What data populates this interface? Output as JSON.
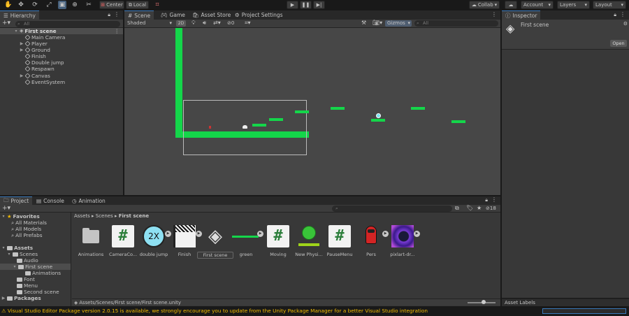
{
  "toolbar": {
    "center_label": "Center",
    "local_label": "Local",
    "collab_label": "Collab",
    "account_label": "Account",
    "layers_label": "Layers",
    "layout_label": "Layout"
  },
  "hierarchy": {
    "tab_label": "Hierarchy",
    "search_placeholder": "All",
    "scene_name": "First scene",
    "items": [
      {
        "label": "Main Camera",
        "has_children": false
      },
      {
        "label": "Player",
        "has_children": true
      },
      {
        "label": "Ground",
        "has_children": true
      },
      {
        "label": "Finish",
        "has_children": false
      },
      {
        "label": "Double jump",
        "has_children": false
      },
      {
        "label": "Respawn",
        "has_children": false
      },
      {
        "label": "Canvas",
        "has_children": true
      },
      {
        "label": "EventSystem",
        "has_children": false
      }
    ]
  },
  "scene_tabs": {
    "scene": "Scene",
    "game": "Game",
    "asset_store": "Asset Store",
    "project_settings": "Project Settings"
  },
  "scene_toolbar": {
    "shading_mode": "Shaded",
    "mode_2d": "2D",
    "hidden_count": "0",
    "gizmos_label": "Gizmos",
    "search_placeholder": "All"
  },
  "inspector": {
    "tab_label": "Inspector",
    "object_name": "First scene",
    "open_button": "Open",
    "asset_labels": "Asset Labels"
  },
  "bottom_tabs": {
    "project": "Project",
    "console": "Console",
    "animation": "Animation"
  },
  "project": {
    "hidden_count": "18",
    "favorites_label": "Favorites",
    "favorites": [
      "All Materials",
      "All Models",
      "All Prefabs"
    ],
    "assets_label": "Assets",
    "tree": {
      "scenes": "Scenes",
      "audio": "Audio",
      "first_scene": "First scene",
      "animations": "Animations",
      "font": "Font",
      "menu": "Menu",
      "second_scene": "Second scene",
      "packages": "Packages"
    },
    "breadcrumb": [
      "Assets",
      "Scenes",
      "First scene"
    ],
    "assets": [
      {
        "label": "Animations",
        "kind": "folder"
      },
      {
        "label": "CameraCo...",
        "kind": "script"
      },
      {
        "label": "double jump",
        "kind": "prefab-2x"
      },
      {
        "label": "Finish",
        "kind": "prefab-finish"
      },
      {
        "label": "First scene",
        "kind": "scene"
      },
      {
        "label": "green",
        "kind": "prefab-green"
      },
      {
        "label": "Moving",
        "kind": "script"
      },
      {
        "label": "New Physi...",
        "kind": "physics-material"
      },
      {
        "label": "PauseMenu",
        "kind": "script"
      },
      {
        "label": "Pers",
        "kind": "prefab-pers"
      },
      {
        "label": "pixlart-dr...",
        "kind": "prefab-image"
      }
    ],
    "selected_path": "Assets/Scenes/First scene/First scene.unity"
  },
  "status_bar": {
    "message": "Visual Studio Editor Package version 2.0.15 is available, we strongly encourage you to update from the Unity Package Manager for a better Visual Studio integration"
  },
  "colors": {
    "accent_blue": "#3a79bb",
    "platform_green": "#14d64a",
    "warning_yellow": "#f4bc02"
  }
}
